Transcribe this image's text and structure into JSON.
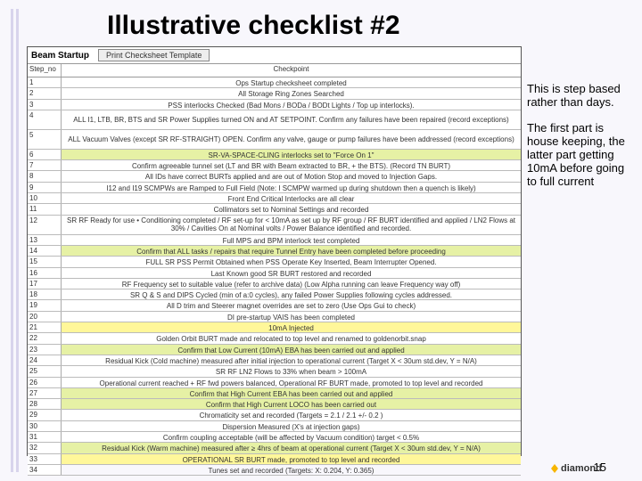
{
  "title": "Illustrative checklist #2",
  "side": {
    "p1": "This is step based rather than days.",
    "p2": "The first part is house keeping, the latter part getting 10mA before going to full current"
  },
  "shot": {
    "label": "Beam Startup",
    "button": "Print Checksheet Template",
    "hdr_step": "Step_no",
    "hdr_check": "Checkpoint"
  },
  "rows": [
    {
      "n": "1",
      "t": "Ops Startup checksheet completed"
    },
    {
      "n": "2",
      "t": "All Storage Ring Zones Searched"
    },
    {
      "n": "3",
      "t": "PSS interlocks Checked (Bad Mons / BODa / BODt Lights / Top up interlocks)."
    },
    {
      "n": "4",
      "t": "ALL I1, LTB, BR, BTS and SR Power Supplies turned ON and AT SETPOINT. Confirm any failures have been repaired (record exceptions)",
      "tall": true
    },
    {
      "n": "5",
      "t": "ALL Vacuum Valves (except SR RF-STRAIGHT) OPEN. Confirm any valve, gauge or pump failures have been addressed (record exceptions)",
      "tall": true
    },
    {
      "n": "6",
      "t": "SR-VA-SPACE-CLING interlocks set to \"Force On 1\"",
      "hl": "green"
    },
    {
      "n": "7",
      "t": "Confirm agreeable tunnel set (LT and BR with Beam extracted to BR, + the BTS). (Record TN BURT)"
    },
    {
      "n": "8",
      "t": "All IDs have correct BURTs applied and are out of Motion Stop and moved to Injection Gaps."
    },
    {
      "n": "9",
      "t": "I12 and I19 SCMPWs are Ramped to Full Field (Note: I SCMPW warmed up during shutdown then a quench is likely)"
    },
    {
      "n": "10",
      "t": "Front End Critical Interlocks are all clear"
    },
    {
      "n": "11",
      "t": "Collimators set to Nominal Settings and recorded"
    },
    {
      "n": "12",
      "t": "SR RF Ready for use • Conditioning completed / RF set-up for < 10mA as set up by RF group / RF BURT identified and applied / LN2 Flows at 30% / Cavities On at Nominal volts / Power Balance identified and recorded.",
      "tall": true
    },
    {
      "n": "13",
      "t": "Full MPS and BPM interlock test completed"
    },
    {
      "n": "14",
      "t": "Confirm that ALL tasks / repairs that require Tunnel Entry have been completed before proceeding",
      "hl": "green"
    },
    {
      "n": "15",
      "t": "FULL SR PSS Permit Obtained when PSS Operate Key Inserted, Beam Interrupter Opened."
    },
    {
      "n": "16",
      "t": "Last Known good SR BURT restored and recorded"
    },
    {
      "n": "17",
      "t": "RF Frequency set to suitable value (refer to archive data) (Low Alpha running can leave Frequency way off)"
    },
    {
      "n": "18",
      "t": "SR Q & S and DIPS Cycled (min of a:0 cycles), any failed Power Supplies following cycles addressed."
    },
    {
      "n": "19",
      "t": "All D trim and Steerer magnet overrides are set to zero (Use Ops Gui to check)"
    },
    {
      "n": "20",
      "t": "DI pre-startup VAIS has been completed"
    },
    {
      "n": "21",
      "t": "10mA Injected",
      "hl": "yellow"
    },
    {
      "n": "22",
      "t": "Golden Orbit BURT made and relocated to top level and renamed to goldenorbit.snap"
    },
    {
      "n": "23",
      "t": "Confirm that Low Current (10mA) EBA has been carried out and applied",
      "hl": "green"
    },
    {
      "n": "24",
      "t": "Residual Kick (Cold machine) measured after initial injection to operational current (Target X < 30um std.dev, Y = N/A)"
    },
    {
      "n": "25",
      "t": "SR RF LN2 Flows to 33% when beam > 100mA"
    },
    {
      "n": "26",
      "t": "Operational current reached + RF fwd powers balanced, Operational RF BURT made, promoted to top level and recorded"
    },
    {
      "n": "27",
      "t": "Confirm that High Current EBA has been carried out and applied",
      "hl": "green"
    },
    {
      "n": "28",
      "t": "Confirm that High Current LOCO has been carried out",
      "hl": "green"
    },
    {
      "n": "29",
      "t": "Chromaticity set and recorded (Targets = 2.1 / 2.1 +/- 0.2 )"
    },
    {
      "n": "30",
      "t": "Dispersion Measured (X's at injection gaps)"
    },
    {
      "n": "31",
      "t": "Confirm coupling acceptable (will be affected by Vacuum condition) target < 0.5%"
    },
    {
      "n": "32",
      "t": "Residual Kick (Warm machine) measured after ≥ 4hrs of beam at operational current (Target X < 30um std.dev, Y = N/A)",
      "hl": "green"
    },
    {
      "n": "33",
      "t": "OPERATIONAL SR BURT made, promoted to top level and recorded",
      "hl": "yellow"
    },
    {
      "n": "34",
      "t": "Tunes set and recorded (Targets: X: 0.204, Y: 0.365)"
    }
  ],
  "pagenum": "15",
  "logo_text": "diamond"
}
